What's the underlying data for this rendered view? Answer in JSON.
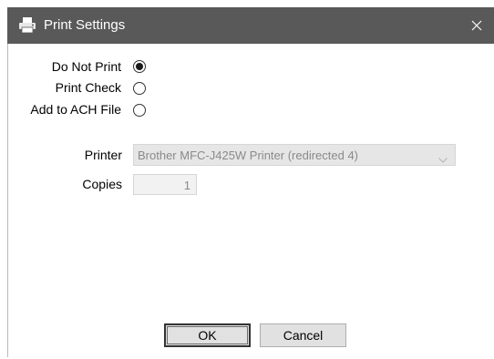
{
  "window": {
    "title": "Print Settings",
    "title_icon": "printer-icon",
    "close_icon": "close-icon"
  },
  "print_options": [
    {
      "label": "Do Not Print",
      "selected": true
    },
    {
      "label": "Print Check",
      "selected": false
    },
    {
      "label": "Add to ACH File",
      "selected": false
    }
  ],
  "printer": {
    "label": "Printer",
    "value": "Brother MFC-J425W Printer (redirected 4)"
  },
  "copies": {
    "label": "Copies",
    "value": "1"
  },
  "buttons": {
    "ok": "OK",
    "cancel": "Cancel"
  },
  "colors": {
    "titlebar": "#595959",
    "disabled_text": "#8a8a8a",
    "button_face": "#e1e1e1"
  }
}
